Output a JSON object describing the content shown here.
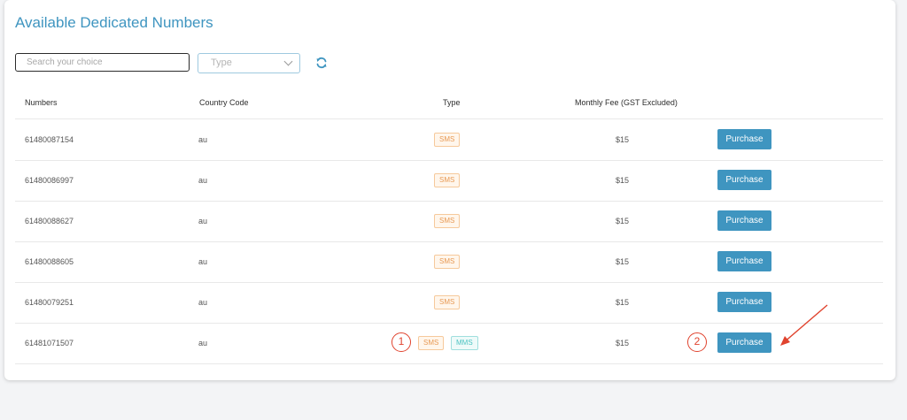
{
  "page": {
    "title": "Available Dedicated Numbers"
  },
  "filters": {
    "search_placeholder": "Search your choice",
    "type_placeholder": "Type",
    "refresh_icon": "refresh-icon"
  },
  "table": {
    "headers": {
      "numbers": "Numbers",
      "country_code": "Country Code",
      "type": "Type",
      "monthly_fee": "Monthly Fee (GST Excluded)"
    },
    "rows": [
      {
        "number": "61480087154",
        "country": "au",
        "types": [
          "SMS"
        ],
        "fee": "$15",
        "action": "Purchase"
      },
      {
        "number": "61480086997",
        "country": "au",
        "types": [
          "SMS"
        ],
        "fee": "$15",
        "action": "Purchase"
      },
      {
        "number": "61480088627",
        "country": "au",
        "types": [
          "SMS"
        ],
        "fee": "$15",
        "action": "Purchase"
      },
      {
        "number": "61480088605",
        "country": "au",
        "types": [
          "SMS"
        ],
        "fee": "$15",
        "action": "Purchase"
      },
      {
        "number": "61480079251",
        "country": "au",
        "types": [
          "SMS"
        ],
        "fee": "$15",
        "action": "Purchase"
      },
      {
        "number": "61481071507",
        "country": "au",
        "types": [
          "SMS",
          "MMS"
        ],
        "fee": "$15",
        "action": "Purchase"
      }
    ]
  },
  "annotations": {
    "marker_1": "1",
    "marker_2": "2",
    "annotation_color": "#e0432e"
  },
  "colors": {
    "accent": "#3f95c0",
    "sms": "#e89a55",
    "mms": "#4cc3c2"
  }
}
